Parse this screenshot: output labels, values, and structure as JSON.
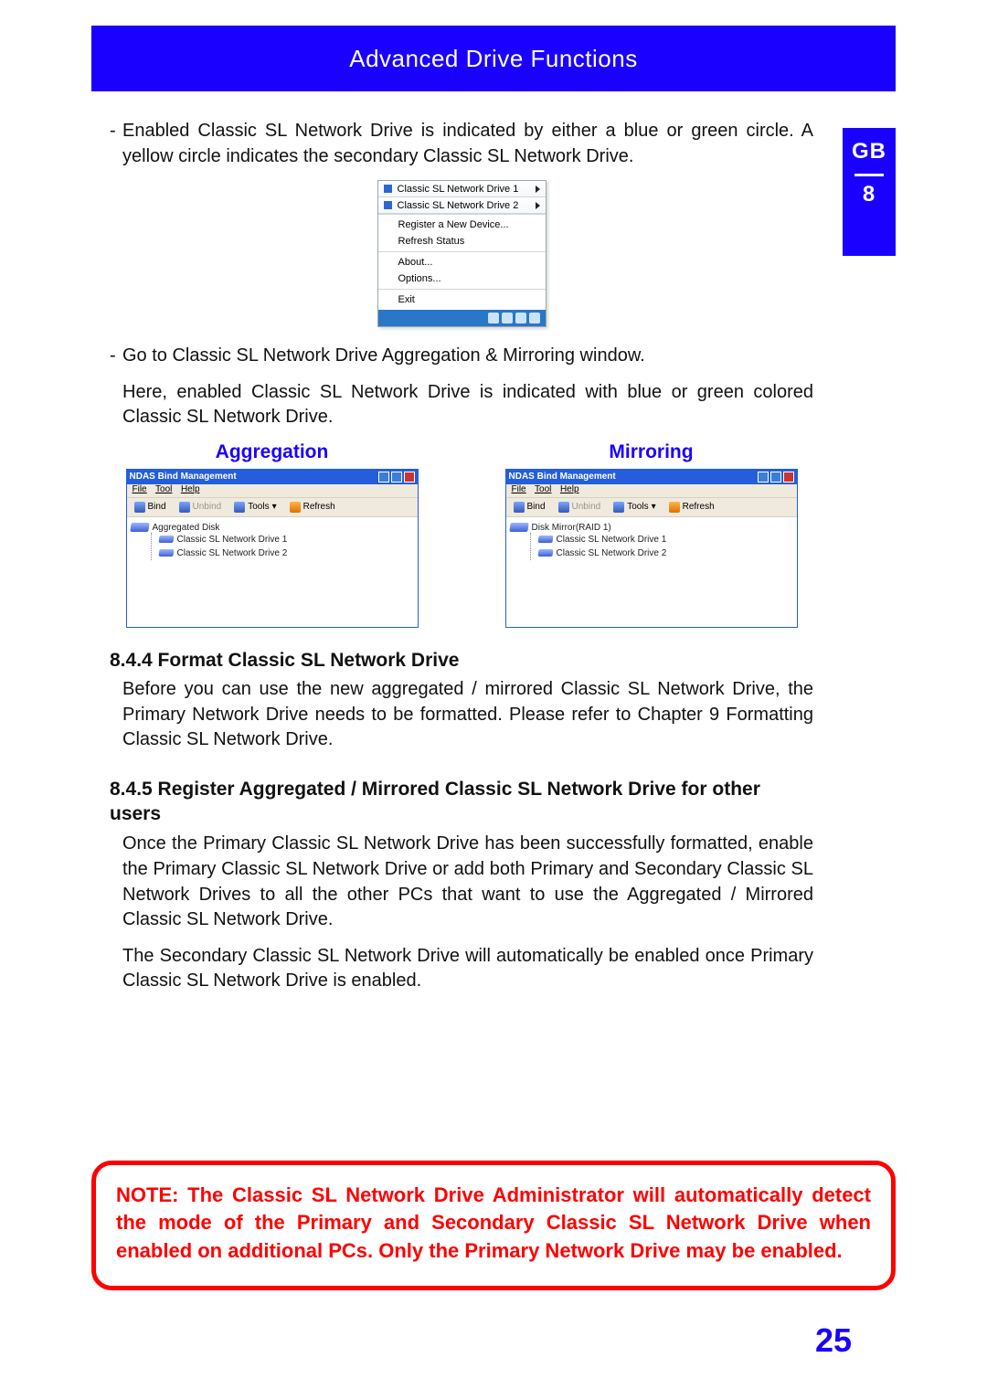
{
  "header_title": "Advanced Drive Functions",
  "side_tab": {
    "lang": "GB",
    "chapter": "8"
  },
  "bullet1": "Enabled Classic SL Network Drive is indicated by either a blue or green circle. A yellow circle indicates the secondary Classic SL Network Drive.",
  "context_menu": {
    "drives": [
      "Classic SL Network Drive 1",
      "Classic SL Network Drive 2"
    ],
    "items_g1": [
      "Register a New Device...",
      "Refresh Status"
    ],
    "items_g2": [
      "About...",
      "Options..."
    ],
    "items_g3": [
      "Exit"
    ]
  },
  "bullet2": "Go to Classic SL Network Drive Aggregation & Mirroring window.",
  "bullet2_sub": "Here, enabled Classic SL Network Drive is indicated with blue or green colored Classic SL Network Drive.",
  "cols": {
    "aggregation_label": "Aggregation",
    "mirroring_label": "Mirroring",
    "window_title": "NDAS Bind Management",
    "menu_file": "File",
    "menu_tool": "Tool",
    "menu_help": "Help",
    "toolbar": {
      "bind": "Bind",
      "unbind": "Unbind",
      "tools": "Tools",
      "refresh": "Refresh"
    },
    "agg_root": "Aggregated Disk",
    "mirror_root": "Disk Mirror(RAID 1)",
    "child1": "Classic SL Network Drive 1",
    "child2": "Classic SL Network Drive 2"
  },
  "sec_844_title": "8.4.4 Format Classic SL Network Drive",
  "sec_844_body": "Before you can use the new aggregated / mirrored Classic SL Network Drive, the Primary Network Drive needs to be formatted. Please refer to Chapter 9 Formatting Classic SL Network Drive.",
  "sec_845_title": "8.4.5 Register Aggregated / Mirrored Classic SL Network Drive for other users",
  "sec_845_body1": "Once the Primary Classic SL Network Drive has been successfully formatted, enable the Primary Classic SL Network Drive or add both Primary and Secondary Classic SL Network Drives to all the other PCs that want to use the Aggregated / Mirrored Classic SL Network Drive.",
  "sec_845_body2": "The Secondary Classic SL Network Drive will automatically be enabled once Primary Classic SL Network Drive is enabled.",
  "note": "NOTE: The Classic SL Network Drive Administrator will automatically detect the mode of the Primary and Secondary Classic SL Network Drive when enabled on additional PCs. Only the Primary Network Drive may be enabled.",
  "page_number": "25"
}
